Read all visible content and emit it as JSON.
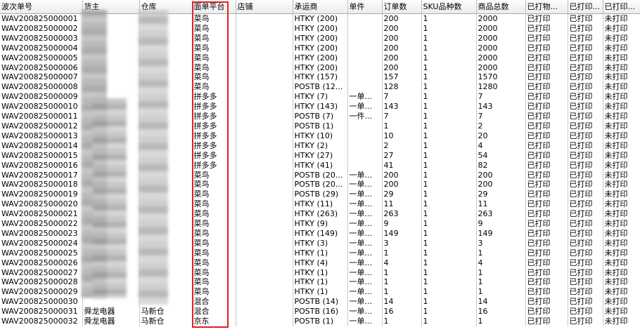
{
  "columns": [
    {
      "key": "wave",
      "label": "波次单号",
      "w": 117
    },
    {
      "key": "owner",
      "label": "货主",
      "w": 81
    },
    {
      "key": "warehouse",
      "label": "仓库",
      "w": 75
    },
    {
      "key": "platform",
      "label": "面单平台",
      "w": 62
    },
    {
      "key": "shop",
      "label": "店铺",
      "w": 81
    },
    {
      "key": "carrier",
      "label": "承运商",
      "w": 78
    },
    {
      "key": "single",
      "label": "单件",
      "w": 49
    },
    {
      "key": "orders",
      "label": "订单数",
      "w": 56
    },
    {
      "key": "sku",
      "label": "SKU品种数",
      "w": 78
    },
    {
      "key": "items",
      "label": "商品总数",
      "w": 70
    },
    {
      "key": "p1",
      "label": "已打物...",
      "w": 60
    },
    {
      "key": "p2",
      "label": "已打印...",
      "w": 50
    },
    {
      "key": "p3",
      "label": "已打印...",
      "w": 53
    }
  ],
  "rows": [
    {
      "wave": "WAV200825000001",
      "owner": "",
      "warehouse": "",
      "platform": "菜鸟",
      "shop": "",
      "carrier": "HTKY (200)",
      "single": "",
      "orders": "200",
      "sku": "1",
      "items": "2000",
      "p1": "已打印",
      "p2": "已打印",
      "p3": "未打印"
    },
    {
      "wave": "WAV200825000002",
      "owner": "",
      "warehouse": "",
      "platform": "菜鸟",
      "shop": "",
      "carrier": "HTKY (200)",
      "single": "",
      "orders": "200",
      "sku": "1",
      "items": "2000",
      "p1": "已打印",
      "p2": "已打印",
      "p3": "未打印"
    },
    {
      "wave": "WAV200825000003",
      "owner": "",
      "warehouse": "",
      "platform": "菜鸟",
      "shop": "",
      "carrier": "HTKY (200)",
      "single": "",
      "orders": "200",
      "sku": "1",
      "items": "2000",
      "p1": "已打印",
      "p2": "已打印",
      "p3": "未打印"
    },
    {
      "wave": "WAV200825000004",
      "owner": "",
      "warehouse": "",
      "platform": "菜鸟",
      "shop": "",
      "carrier": "HTKY (200)",
      "single": "",
      "orders": "200",
      "sku": "1",
      "items": "2000",
      "p1": "已打印",
      "p2": "已打印",
      "p3": "未打印"
    },
    {
      "wave": "WAV200825000005",
      "owner": "",
      "warehouse": "",
      "platform": "菜鸟",
      "shop": "",
      "carrier": "HTKY (200)",
      "single": "",
      "orders": "200",
      "sku": "1",
      "items": "2000",
      "p1": "已打印",
      "p2": "已打印",
      "p3": "未打印"
    },
    {
      "wave": "WAV200825000006",
      "owner": "",
      "warehouse": "",
      "platform": "菜鸟",
      "shop": "",
      "carrier": "HTKY (200)",
      "single": "",
      "orders": "200",
      "sku": "1",
      "items": "2000",
      "p1": "已打印",
      "p2": "已打印",
      "p3": "未打印"
    },
    {
      "wave": "WAV200825000007",
      "owner": "",
      "warehouse": "",
      "platform": "菜鸟",
      "shop": "",
      "carrier": "HTKY (157)",
      "single": "",
      "orders": "157",
      "sku": "1",
      "items": "1570",
      "p1": "已打印",
      "p2": "已打印",
      "p3": "未打印"
    },
    {
      "wave": "WAV200825000008",
      "owner": "",
      "warehouse": "",
      "platform": "菜鸟",
      "shop": "",
      "carrier": "POSTB (12...",
      "single": "",
      "orders": "128",
      "sku": "1",
      "items": "1280",
      "p1": "已打印",
      "p2": "已打印",
      "p3": "未打印"
    },
    {
      "wave": "WAV200825000009",
      "owner": "",
      "warehouse": "",
      "platform": "拼多多",
      "shop": "",
      "carrier": "HTKY (7)",
      "single": "一单...",
      "orders": "7",
      "sku": "1",
      "items": "7",
      "p1": "已打印",
      "p2": "已打印",
      "p3": "未打印"
    },
    {
      "wave": "WAV200825000010",
      "owner": "",
      "warehouse": "",
      "platform": "拼多多",
      "shop": "",
      "carrier": "HTKY (143)",
      "single": "一单...",
      "orders": "143",
      "sku": "1",
      "items": "143",
      "p1": "已打印",
      "p2": "已打印",
      "p3": "未打印"
    },
    {
      "wave": "WAV200825000011",
      "owner": "",
      "warehouse": "",
      "platform": "拼多多",
      "shop": "",
      "carrier": "POSTB (7)",
      "single": "一件...",
      "orders": "7",
      "sku": "1",
      "items": "7",
      "p1": "已打印",
      "p2": "已打印",
      "p3": "未打印"
    },
    {
      "wave": "WAV200825000012",
      "owner": "",
      "warehouse": "",
      "platform": "拼多多",
      "shop": "",
      "carrier": "POSTB (1)",
      "single": "",
      "orders": "1",
      "sku": "1",
      "items": "2",
      "p1": "已打印",
      "p2": "已打印",
      "p3": "未打印"
    },
    {
      "wave": "WAV200825000013",
      "owner": "",
      "warehouse": "",
      "platform": "拼多多",
      "shop": "",
      "carrier": "HTKY (10)",
      "single": "",
      "orders": "10",
      "sku": "1",
      "items": "20",
      "p1": "已打印",
      "p2": "已打印",
      "p3": "未打印"
    },
    {
      "wave": "WAV200825000014",
      "owner": "",
      "warehouse": "",
      "platform": "拼多多",
      "shop": "",
      "carrier": "HTKY (2)",
      "single": "",
      "orders": "2",
      "sku": "1",
      "items": "4",
      "p1": "已打印",
      "p2": "已打印",
      "p3": "未打印"
    },
    {
      "wave": "WAV200825000015",
      "owner": "",
      "warehouse": "",
      "platform": "拼多多",
      "shop": "",
      "carrier": "HTKY (27)",
      "single": "",
      "orders": "27",
      "sku": "1",
      "items": "54",
      "p1": "已打印",
      "p2": "已打印",
      "p3": "未打印"
    },
    {
      "wave": "WAV200825000016",
      "owner": "",
      "warehouse": "",
      "platform": "拼多多",
      "shop": "",
      "carrier": "HTKY (41)",
      "single": "",
      "orders": "41",
      "sku": "1",
      "items": "82",
      "p1": "已打印",
      "p2": "已打印",
      "p3": "未打印"
    },
    {
      "wave": "WAV200825000017",
      "owner": "",
      "warehouse": "",
      "platform": "菜鸟",
      "shop": "",
      "carrier": "POSTB (20...",
      "single": "一单...",
      "orders": "200",
      "sku": "1",
      "items": "200",
      "p1": "已打印",
      "p2": "已打印",
      "p3": "未打印"
    },
    {
      "wave": "WAV200825000018",
      "owner": "",
      "warehouse": "",
      "platform": "菜鸟",
      "shop": "",
      "carrier": "POSTB (20...",
      "single": "一单...",
      "orders": "200",
      "sku": "1",
      "items": "200",
      "p1": "已打印",
      "p2": "已打印",
      "p3": "未打印"
    },
    {
      "wave": "WAV200825000019",
      "owner": "",
      "warehouse": "",
      "platform": "菜鸟",
      "shop": "",
      "carrier": "POSTB (29)",
      "single": "一单...",
      "orders": "29",
      "sku": "1",
      "items": "29",
      "p1": "已打印",
      "p2": "已打印",
      "p3": "未打印"
    },
    {
      "wave": "WAV200825000020",
      "owner": "",
      "warehouse": "",
      "platform": "菜鸟",
      "shop": "",
      "carrier": "HTKY (11)",
      "single": "一单...",
      "orders": "11",
      "sku": "1",
      "items": "11",
      "p1": "已打印",
      "p2": "已打印",
      "p3": "未打印"
    },
    {
      "wave": "WAV200825000021",
      "owner": "",
      "warehouse": "",
      "platform": "菜鸟",
      "shop": "",
      "carrier": "HTKY (263)",
      "single": "一单...",
      "orders": "263",
      "sku": "1",
      "items": "263",
      "p1": "已打印",
      "p2": "已打印",
      "p3": "未打印"
    },
    {
      "wave": "WAV200825000022",
      "owner": "",
      "warehouse": "",
      "platform": "菜鸟",
      "shop": "",
      "carrier": "HTKY (9)",
      "single": "一单...",
      "orders": "9",
      "sku": "1",
      "items": "9",
      "p1": "已打印",
      "p2": "已打印",
      "p3": "未打印"
    },
    {
      "wave": "WAV200825000023",
      "owner": "",
      "warehouse": "",
      "platform": "菜鸟",
      "shop": "",
      "carrier": "HTKY (149)",
      "single": "一单...",
      "orders": "149",
      "sku": "1",
      "items": "149",
      "p1": "已打印",
      "p2": "已打印",
      "p3": "未打印"
    },
    {
      "wave": "WAV200825000024",
      "owner": "",
      "warehouse": "",
      "platform": "菜鸟",
      "shop": "",
      "carrier": "HTKY (3)",
      "single": "一单...",
      "orders": "3",
      "sku": "1",
      "items": "3",
      "p1": "已打印",
      "p2": "已打印",
      "p3": "未打印"
    },
    {
      "wave": "WAV200825000025",
      "owner": "",
      "warehouse": "",
      "platform": "菜鸟",
      "shop": "",
      "carrier": "HTKY (1)",
      "single": "一单...",
      "orders": "1",
      "sku": "1",
      "items": "1",
      "p1": "已打印",
      "p2": "已打印",
      "p3": "未打印"
    },
    {
      "wave": "WAV200825000026",
      "owner": "",
      "warehouse": "",
      "platform": "菜鸟",
      "shop": "",
      "carrier": "HTKY (4)",
      "single": "一单...",
      "orders": "4",
      "sku": "1",
      "items": "4",
      "p1": "已打印",
      "p2": "已打印",
      "p3": "未打印"
    },
    {
      "wave": "WAV200825000027",
      "owner": "",
      "warehouse": "",
      "platform": "菜鸟",
      "shop": "",
      "carrier": "HTKY (1)",
      "single": "一单...",
      "orders": "1",
      "sku": "1",
      "items": "1",
      "p1": "已打印",
      "p2": "已打印",
      "p3": "未打印"
    },
    {
      "wave": "WAV200825000028",
      "owner": "",
      "warehouse": "",
      "platform": "菜鸟",
      "shop": "",
      "carrier": "HTKY (1)",
      "single": "一单...",
      "orders": "1",
      "sku": "1",
      "items": "1",
      "p1": "已打印",
      "p2": "已打印",
      "p3": "未打印"
    },
    {
      "wave": "WAV200825000029",
      "owner": "",
      "warehouse": "",
      "platform": "菜鸟",
      "shop": "",
      "carrier": "HTKY (1)",
      "single": "一单...",
      "orders": "1",
      "sku": "1",
      "items": "1",
      "p1": "已打印",
      "p2": "已打印",
      "p3": "未打印"
    },
    {
      "wave": "WAV200825000030",
      "owner": "",
      "warehouse": "",
      "platform": "混合",
      "shop": "",
      "carrier": "POSTB (14)",
      "single": "一单...",
      "orders": "14",
      "sku": "1",
      "items": "14",
      "p1": "已打印",
      "p2": "已打印",
      "p3": "未打印"
    },
    {
      "wave": "WAV200825000031",
      "owner": "舜龙电器",
      "warehouse": "马新仓",
      "platform": "混合",
      "shop": "",
      "carrier": "POSTB (16)",
      "single": "一单...",
      "orders": "16",
      "sku": "1",
      "items": "16",
      "p1": "已打印",
      "p2": "已打印",
      "p3": "未打印"
    },
    {
      "wave": "WAV200825000032",
      "owner": "舜龙电器",
      "warehouse": "马新仓",
      "platform": "京东",
      "shop": "",
      "carrier": "POSTB (1)",
      "single": "一单...",
      "orders": "1",
      "sku": "1",
      "items": "1",
      "p1": "已打印",
      "p2": "已打印",
      "p3": "未打印"
    }
  ]
}
